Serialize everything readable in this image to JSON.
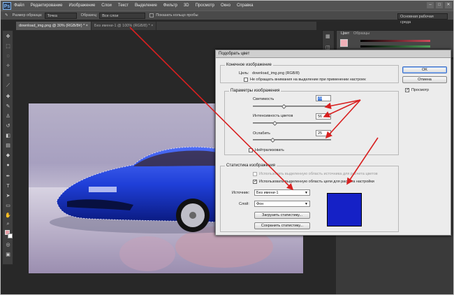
{
  "app": {
    "logo": "Ps",
    "menu": [
      "Файл",
      "Редактирование",
      "Изображение",
      "Слои",
      "Текст",
      "Выделение",
      "Фильтр",
      "3D",
      "Просмотр",
      "Окно",
      "Справка"
    ],
    "window_controls": [
      "–",
      "□",
      "✕"
    ]
  },
  "options_bar": {
    "size_label": "Размер образца:",
    "size_value": "Точка",
    "sample_label": "Образец:",
    "sample_value": "Все слои",
    "ring_label": "Показать кольцо пробы",
    "workspace": "Основная рабочая среда"
  },
  "tabs": [
    {
      "label": "download_img.png @ 30% (RGB/8#) *",
      "close": "×"
    },
    {
      "label": "Без имени-1 @ 100% (RGB/8) *",
      "close": "×"
    }
  ],
  "panel": {
    "tabs": [
      "Цвет",
      "Образцы"
    ],
    "colors": {
      "slider_r": "#d14a5a",
      "slider_g": "#4ea35a",
      "slider_b": "#4a6bd1"
    }
  },
  "dialog": {
    "title": "Подобрать цвет",
    "target_group": "Конечное изображение",
    "target_label": "Цель:",
    "target_value": "download_img.png (RGB/8)",
    "ignore_selection": "Не обращать внимания на выделение при применении настроек",
    "options_group": "Параметры изображения",
    "luminance_label": "Светимость",
    "luminance_value": "70",
    "intensity_label": "Интенсивность цветов",
    "intensity_value": "56",
    "fade_label": "Ослабить",
    "fade_value": "25",
    "neutralize": "Нейтрализовать",
    "stats_group": "Статистика изображения",
    "use_source_selection": "Использовать выделенную область источника для расчета цветов",
    "use_target_selection": "Использовать выделенную область цели для расчета настройки",
    "source_label": "Источник:",
    "source_value": "Без имени-1",
    "layer_label": "Слой:",
    "layer_value": "Фон",
    "load_stats": "Загрузить статистику...",
    "save_stats": "Сохранить статистику...",
    "ok": "OK",
    "cancel": "Отмена",
    "preview": "Просмотр",
    "swatch_color": "#1521c6"
  }
}
